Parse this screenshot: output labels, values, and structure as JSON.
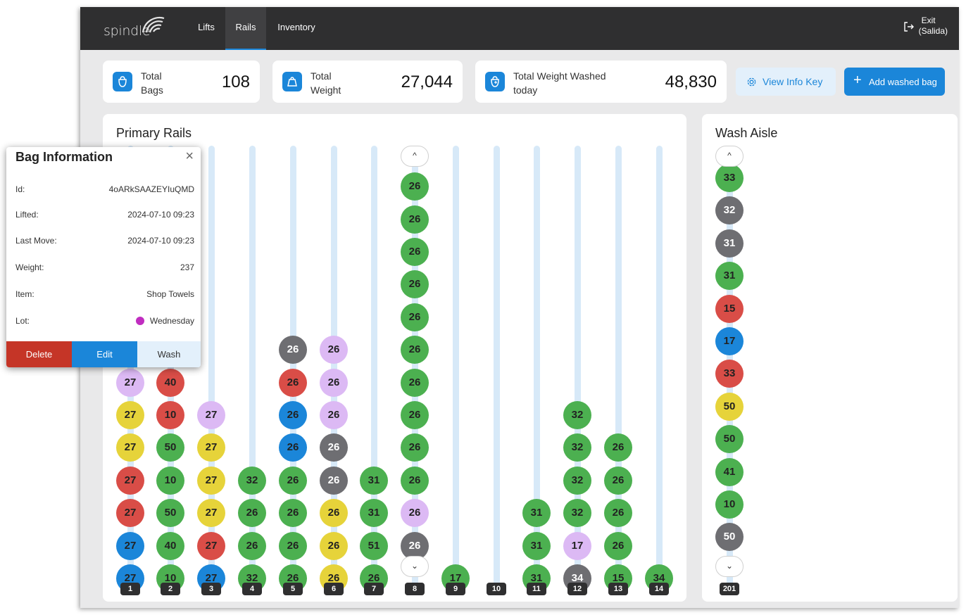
{
  "colors": {
    "green": "#4cb050",
    "gray": "#6e6e72",
    "red": "#d94d47",
    "blue": "#1b86d9",
    "yellow": "#e6d33a",
    "purple": "#dcb9f4",
    "accent": "#1b86d9",
    "delete": "#c53527",
    "navbar": "#2f2f30"
  },
  "nav": {
    "brand": "spindle",
    "tabs": [
      "Lifts",
      "Rails",
      "Inventory"
    ],
    "active_tab": "Rails",
    "exit_line1": "Exit",
    "exit_line2": "(Salida)"
  },
  "stats": [
    {
      "label_line1": "Total",
      "label_line2": "Bags",
      "value": "108"
    },
    {
      "label_line1": "Total",
      "label_line2": "Weight",
      "value": "27,044"
    },
    {
      "label_line1": "Total Weight Washed",
      "label_line2": "today",
      "value": "48,830"
    }
  ],
  "buttons": {
    "view_info_key": "View Info Key",
    "add_washed_bag": "Add washed bag"
  },
  "primary_rails": {
    "title": "Primary Rails",
    "rails": [
      {
        "label": "1",
        "bags": [
          [
            "27",
            "purple"
          ],
          [
            "27",
            "yellow"
          ],
          [
            "27",
            "yellow"
          ],
          [
            "27",
            "red"
          ],
          [
            "27",
            "red"
          ],
          [
            "27",
            "blue"
          ],
          [
            "27",
            "blue"
          ]
        ]
      },
      {
        "label": "2",
        "bags": [
          [
            "40",
            "red"
          ],
          [
            "10",
            "red"
          ],
          [
            "50",
            "green"
          ],
          [
            "10",
            "green"
          ],
          [
            "50",
            "green"
          ],
          [
            "40",
            "green"
          ],
          [
            "10",
            "green"
          ]
        ]
      },
      {
        "label": "3",
        "bags": [
          [
            "27",
            "purple"
          ],
          [
            "27",
            "yellow"
          ],
          [
            "27",
            "yellow"
          ],
          [
            "27",
            "yellow"
          ],
          [
            "27",
            "red"
          ],
          [
            "27",
            "blue"
          ]
        ]
      },
      {
        "label": "4",
        "bags": [
          [
            "32",
            "green"
          ],
          [
            "26",
            "green"
          ],
          [
            "26",
            "green"
          ],
          [
            "32",
            "green"
          ]
        ]
      },
      {
        "label": "5",
        "bags": [
          [
            "26",
            "gray"
          ],
          [
            "26",
            "red"
          ],
          [
            "26",
            "blue"
          ],
          [
            "26",
            "blue"
          ],
          [
            "26",
            "green"
          ],
          [
            "26",
            "green"
          ],
          [
            "26",
            "green"
          ],
          [
            "26",
            "green"
          ]
        ]
      },
      {
        "label": "6",
        "bags": [
          [
            "26",
            "purple"
          ],
          [
            "26",
            "purple"
          ],
          [
            "26",
            "purple"
          ],
          [
            "26",
            "gray"
          ],
          [
            "26",
            "gray"
          ],
          [
            "26",
            "yellow"
          ],
          [
            "26",
            "yellow"
          ],
          [
            "26",
            "yellow"
          ]
        ]
      },
      {
        "label": "7",
        "bags": [
          [
            "31",
            "green"
          ],
          [
            "31",
            "green"
          ],
          [
            "51",
            "green"
          ],
          [
            "26",
            "green"
          ]
        ]
      },
      {
        "label": "8",
        "bags": [
          [
            "26",
            "green"
          ],
          [
            "26",
            "green"
          ],
          [
            "26",
            "green"
          ],
          [
            "26",
            "green"
          ],
          [
            "26",
            "green"
          ],
          [
            "26",
            "green"
          ],
          [
            "26",
            "green"
          ],
          [
            "26",
            "green"
          ],
          [
            "26",
            "green"
          ],
          [
            "26",
            "green"
          ],
          [
            "26",
            "purple"
          ],
          [
            "26",
            "gray"
          ]
        ]
      },
      {
        "label": "9",
        "bags": [
          [
            "17",
            "green"
          ]
        ]
      },
      {
        "label": "10",
        "bags": []
      },
      {
        "label": "11",
        "bags": [
          [
            "31",
            "green"
          ],
          [
            "31",
            "green"
          ],
          [
            "31",
            "green"
          ]
        ]
      },
      {
        "label": "12",
        "bags": [
          [
            "32",
            "green"
          ],
          [
            "32",
            "green"
          ],
          [
            "32",
            "green"
          ],
          [
            "32",
            "green"
          ],
          [
            "17",
            "purple"
          ],
          [
            "34",
            "gray"
          ]
        ]
      },
      {
        "label": "13",
        "bags": [
          [
            "26",
            "green"
          ],
          [
            "26",
            "green"
          ],
          [
            "26",
            "green"
          ],
          [
            "26",
            "green"
          ],
          [
            "15",
            "green"
          ]
        ]
      },
      {
        "label": "14",
        "bags": [
          [
            "34",
            "green"
          ]
        ]
      }
    ]
  },
  "wash_aisle": {
    "title": "Wash Aisle",
    "label": "201",
    "bags": [
      [
        "33",
        "green"
      ],
      [
        "32",
        "gray"
      ],
      [
        "31",
        "gray"
      ],
      [
        "31",
        "green"
      ],
      [
        "15",
        "red"
      ],
      [
        "17",
        "blue"
      ],
      [
        "33",
        "red"
      ],
      [
        "50",
        "yellow"
      ],
      [
        "50",
        "green"
      ],
      [
        "41",
        "green"
      ],
      [
        "10",
        "green"
      ],
      [
        "50",
        "gray"
      ]
    ]
  },
  "popup": {
    "title": "Bag Information",
    "rows": [
      {
        "key": "Id:",
        "value": "4oARkSAAZEYIuQMD"
      },
      {
        "key": "Lifted:",
        "value": "2024-07-10 09:23"
      },
      {
        "key": "Last Move:",
        "value": "2024-07-10 09:23"
      },
      {
        "key": "Weight:",
        "value": "237"
      },
      {
        "key": "Item:",
        "value": "Shop Towels"
      },
      {
        "key": "Lot:",
        "value": "Wednesday"
      }
    ],
    "delete": "Delete",
    "edit": "Edit",
    "wash": "Wash"
  }
}
